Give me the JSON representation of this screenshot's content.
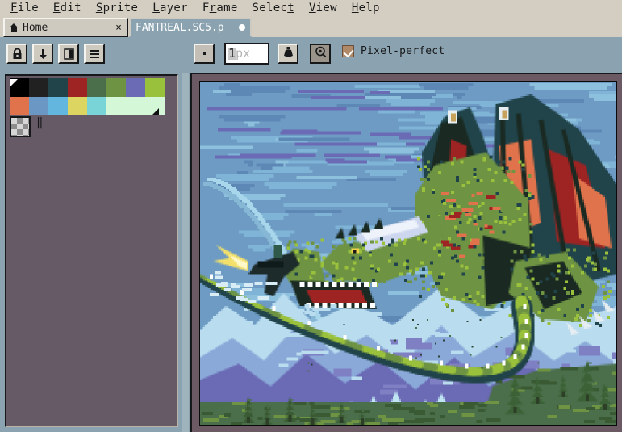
{
  "app": {
    "name": "Aseprite",
    "theme_bg": "#8ba3b0",
    "menubar_bg": "#d4cec2"
  },
  "menubar": {
    "items": [
      {
        "label": "File",
        "mnemonic": "F"
      },
      {
        "label": "Edit",
        "mnemonic": "E"
      },
      {
        "label": "Sprite",
        "mnemonic": "S"
      },
      {
        "label": "Layer",
        "mnemonic": "L"
      },
      {
        "label": "Frame",
        "mnemonic": "r"
      },
      {
        "label": "Select",
        "mnemonic": "t"
      },
      {
        "label": "View",
        "mnemonic": "V"
      },
      {
        "label": "Help",
        "mnemonic": "H"
      }
    ]
  },
  "tabs": {
    "home": {
      "label": "Home",
      "icon": "home-icon",
      "close_label": "×",
      "active": false
    },
    "document": {
      "label": "FANTREAL.SC5.p",
      "modified": true,
      "active": true
    }
  },
  "toolbar": {
    "buttons": [
      {
        "name": "lock-layer-button",
        "icon": "lock-icon",
        "tooltip": "Lock"
      },
      {
        "name": "download-button",
        "icon": "arrow-down-icon",
        "tooltip": "Down"
      },
      {
        "name": "layer-visibility-button",
        "icon": "page-icon",
        "tooltip": "Layer"
      },
      {
        "name": "menu-button",
        "icon": "hamburger-icon",
        "tooltip": "Menu"
      }
    ],
    "brush": {
      "shape": "dot",
      "size_value": "1",
      "size_unit": "px",
      "full": "1px"
    },
    "ink_button": {
      "name": "ink-type-button",
      "icon": "ink-bottle-icon"
    },
    "mode_button": {
      "name": "blend-mode-button",
      "icon": "target-cursor-icon"
    },
    "pixel_perfect": {
      "label": "Pixel-perfect",
      "checked": true,
      "check_color": "#b08a68"
    }
  },
  "palette": {
    "row1": [
      "#000000",
      "#212121",
      "#21444a",
      "#9e2423",
      "#4a6f4a",
      "#6d9343",
      "#6a6ab5",
      "#9ac13c"
    ],
    "row2": [
      "#e0734b",
      "#6b97c4",
      "#63b6dd",
      "#ddd561",
      "#78d4d6",
      "#d3f7d7",
      "#d3f7d7",
      "#d3f7d7"
    ],
    "foreground_index": 0,
    "background_index": 15,
    "transparent_swatch": "checkerboard",
    "pause_glyph": "‖"
  },
  "canvas": {
    "title": "FANTREAL.SC5",
    "background_color": "#6b5a64",
    "art_description": "pixel-art green dragon with red-orange wings flying over blue mountains, pine trees, and a dark jet with yellow flame trail",
    "sky_colors": [
      "#6e9bc4",
      "#7fb4d6",
      "#5d87b5",
      "#6a6ab5"
    ],
    "dragon_colors": [
      "#6d9343",
      "#9ac13c",
      "#21444a",
      "#1a2a22",
      "#9e2423",
      "#e0734b"
    ],
    "mountain_colors": [
      "#b9dcef",
      "#8aa9d8",
      "#6a6ab5",
      "#7f7fc4"
    ],
    "ground_colors": [
      "#6d9343",
      "#4a6f4a",
      "#3a5a33"
    ]
  }
}
